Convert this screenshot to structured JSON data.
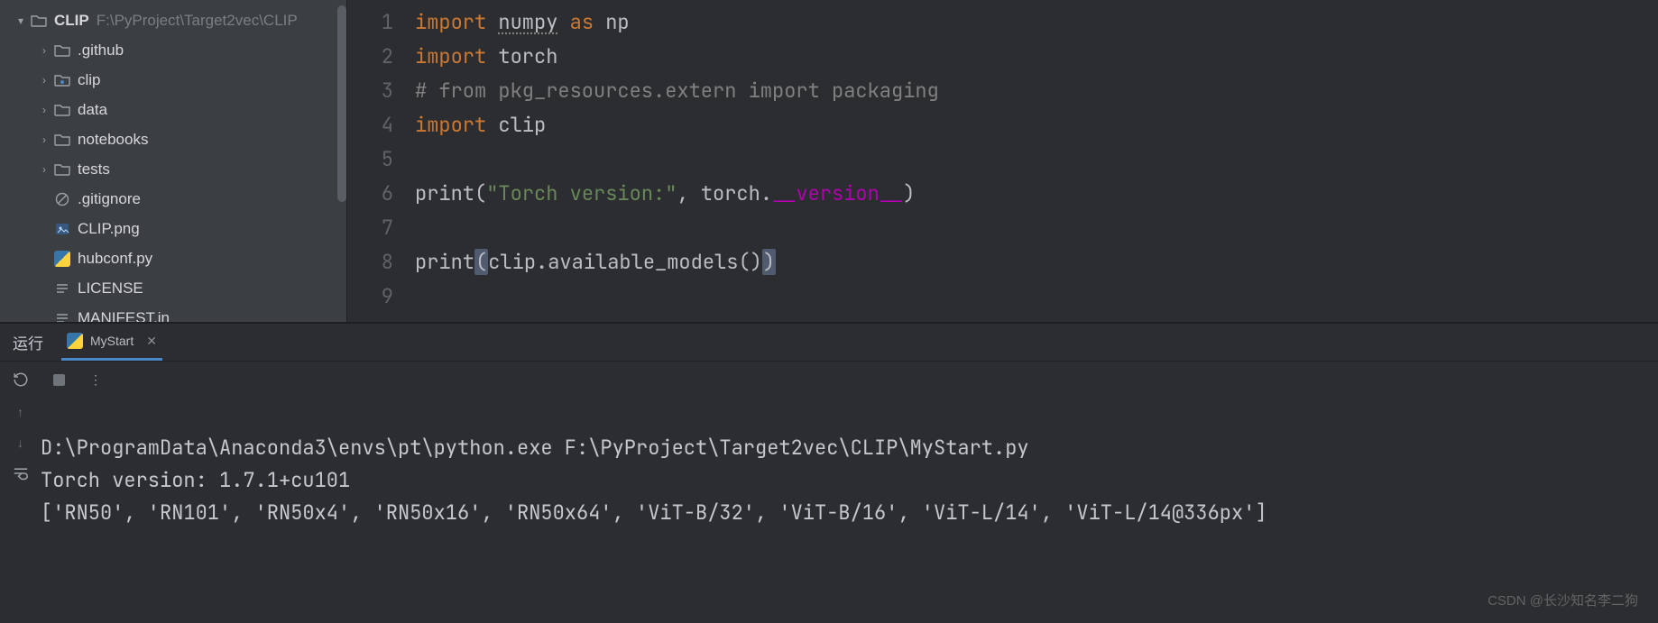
{
  "project": {
    "root_name": "CLIP",
    "root_path": "F:\\PyProject\\Target2vec\\CLIP",
    "items": [
      {
        "name": ".github",
        "kind": "folder",
        "expandable": true
      },
      {
        "name": "clip",
        "kind": "pkg",
        "expandable": true
      },
      {
        "name": "data",
        "kind": "folder",
        "expandable": true
      },
      {
        "name": "notebooks",
        "kind": "folder",
        "expandable": true
      },
      {
        "name": "tests",
        "kind": "folder",
        "expandable": true
      },
      {
        "name": ".gitignore",
        "kind": "ignore",
        "expandable": false
      },
      {
        "name": "CLIP.png",
        "kind": "image",
        "expandable": false
      },
      {
        "name": "hubconf.py",
        "kind": "python",
        "expandable": false
      },
      {
        "name": "LICENSE",
        "kind": "text",
        "expandable": false
      },
      {
        "name": "MANIFEST.in",
        "kind": "text",
        "expandable": false
      }
    ]
  },
  "editor": {
    "gutter": [
      "1",
      "2",
      "3",
      "4",
      "5",
      "6",
      "7",
      "8",
      "9"
    ],
    "c": {
      "import": "import",
      "numpy": "numpy",
      "as": "as",
      "np": "np",
      "torch": "torch",
      "comment": "# from pkg_resources.extern import packaging",
      "clip": "clip",
      "print": "print",
      "lpar": "(",
      "rpar": ")",
      "str1": "\"Torch version:\"",
      "comma": ",",
      "torchdot": "torch.",
      "dunder": "__version__",
      "clipdot": "clip.",
      "avail": "available_models",
      "empty": "()"
    }
  },
  "run": {
    "panel_label": "运行",
    "tab_name": "MyStart",
    "lines": [
      "D:\\ProgramData\\Anaconda3\\envs\\pt\\python.exe F:\\PyProject\\Target2vec\\CLIP\\MyStart.py",
      "Torch version: 1.7.1+cu101",
      "['RN50', 'RN101', 'RN50x4', 'RN50x16', 'RN50x64', 'ViT-B/32', 'ViT-B/16', 'ViT-L/14', 'ViT-L/14@336px']"
    ]
  },
  "watermark": "CSDN @长沙知名李二狗"
}
